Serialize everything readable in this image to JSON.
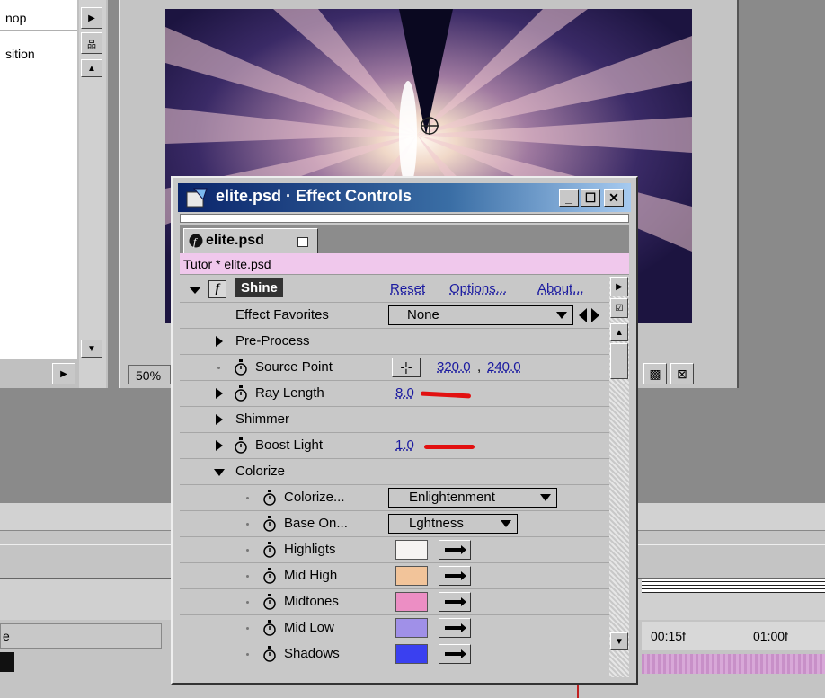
{
  "project_panel": {
    "items": [
      "nop",
      "sition"
    ]
  },
  "composition": {
    "zoom": "50%"
  },
  "timeline": {
    "left_label": "e",
    "timecode_a": "00:15f",
    "timecode_b": "01:00f"
  },
  "effect_controls": {
    "window_title": "elite.psd · Effect Controls",
    "tab_label": "elite.psd",
    "breadcrumb": "Tutor * elite.psd",
    "effect": {
      "fx_badge": "f",
      "name": "Shine",
      "reset": "Reset",
      "options": "Options...",
      "about": "About...",
      "favorites_label": "Effect Favorites",
      "favorites_value": "None"
    },
    "params": {
      "pre_process": "Pre-Process",
      "source_point": {
        "label": "Source Point",
        "x": "320.0",
        "sep": ",",
        "y": "240.0"
      },
      "ray_length": {
        "label": "Ray Length",
        "value": "8.0"
      },
      "shimmer": "Shimmer",
      "boost_light": {
        "label": "Boost Light",
        "value": "1.0"
      },
      "colorize_group": "Colorize",
      "colorize": {
        "label": "Colorize...",
        "value": "Enlightenment"
      },
      "base_on": {
        "label": "Base On...",
        "value": "Lghtness"
      },
      "colors": [
        {
          "label": "Highligts",
          "color": "#f6f4f2"
        },
        {
          "label": "Mid High",
          "color": "#f2c49a"
        },
        {
          "label": "Midtones",
          "color": "#ec8ec4"
        },
        {
          "label": "Mid Low",
          "color": "#a090e8"
        },
        {
          "label": "Shadows",
          "color": "#3a40f0"
        }
      ]
    }
  },
  "colors": {
    "title_bar": "#0a246a",
    "breadcrumb_bg": "#f0c8ec",
    "annotation_red": "#e21010",
    "link": "#1a1aa0"
  }
}
